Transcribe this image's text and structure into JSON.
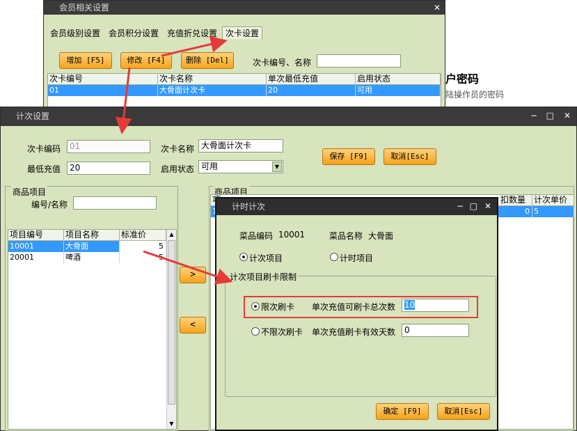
{
  "bg_window": {
    "partial_title_line1": "户密码",
    "partial_title_line2": "陆操作员的密码"
  },
  "member_window": {
    "title": "会员相关设置",
    "tabs": [
      "会员级别设置",
      "会员积分设置",
      "充值折兑设置",
      "次卡设置"
    ],
    "buttons": {
      "add": "增加 [F5]",
      "edit": "修改 [F4]",
      "delete": "删除 [Del]"
    },
    "search_label": "次卡编号、名称",
    "table": {
      "headers": [
        "次卡编号",
        "次卡名称",
        "单次最低充值",
        "启用状态"
      ],
      "rows": [
        [
          "01",
          "大骨面计次卡",
          "20",
          "可用"
        ]
      ]
    }
  },
  "count_window": {
    "title": "计次设置",
    "fields": {
      "card_no_label": "次卡编码",
      "card_no_value": "01",
      "card_name_label": "次卡名称",
      "card_name_value": "大骨面计次卡",
      "min_recharge_label": "最低充值",
      "min_recharge_value": "20",
      "status_label": "启用状态",
      "status_value": "可用"
    },
    "buttons": {
      "save": "保存 [F9]",
      "cancel": "取消[Esc]",
      "add_right": ">",
      "remove_left": "<"
    },
    "left_group": {
      "title": "商品项目",
      "search_label": "编号/名称",
      "headers": [
        "项目编号",
        "项目名称",
        "标准价"
      ],
      "rows": [
        [
          "10001",
          "大骨面",
          "5"
        ],
        [
          "20001",
          "啤酒",
          "5"
        ]
      ]
    },
    "right_group": {
      "title": "商品项目",
      "headers_visible": [
        "项",
        "扣数量",
        "计次单价"
      ],
      "rows": [
        [
          "1",
          "0",
          "5"
        ]
      ]
    }
  },
  "timer_dialog": {
    "title": "计时计次",
    "item_code_label": "菜品编码",
    "item_code_value": "10001",
    "item_name_label": "菜品名称",
    "item_name_value": "大骨面",
    "radio_count": "计次项目",
    "radio_time": "计时项目",
    "group_title": "计次项目刷卡限制",
    "limit_radio": "限次刷卡",
    "limit_field_label": "单次充值可刷卡总次数",
    "limit_value": "10",
    "nolimit_radio": "不限次刷卡",
    "nolimit_field_label": "单次充值刷卡有效天数",
    "nolimit_value": "0",
    "ok_button": "确定 [F9]",
    "cancel_button": "取消[Esc]"
  },
  "colors": {
    "accent_arrow": "#e63a3a",
    "selection": "#3399ff",
    "panel": "#d7e4bd",
    "button": "#f7a21b"
  }
}
